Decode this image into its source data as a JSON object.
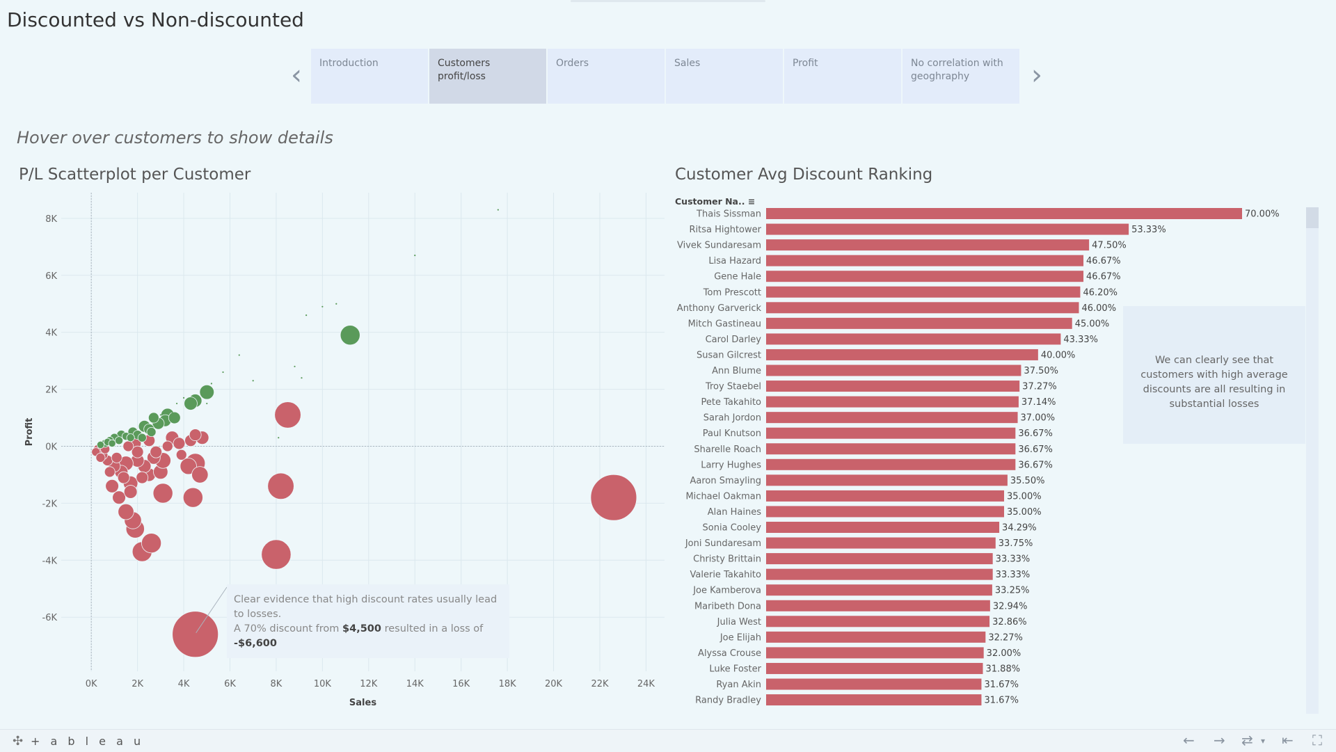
{
  "page": {
    "title": "Discounted vs Non-discounted",
    "subtitle": "Hover over customers to show details"
  },
  "nav": {
    "prev_icon": "chevron-left-icon",
    "next_icon": "chevron-right-icon"
  },
  "tabs": [
    {
      "label": "Introduction",
      "active": false
    },
    {
      "label": "Customers profit/loss",
      "active": true
    },
    {
      "label": "Orders",
      "active": false
    },
    {
      "label": "Sales",
      "active": false
    },
    {
      "label": "Profit",
      "active": false
    },
    {
      "label": "No correlation with geoghraphy",
      "active": false
    }
  ],
  "colors": {
    "loss": "#c9626b",
    "profit": "#5a9a5a",
    "background": "#eef7fa",
    "tab_active": "#d1d9e7",
    "tab": "#e3ecfa"
  },
  "scatter": {
    "title": "P/L Scatterplot per Customer",
    "annotation": {
      "line1": "Clear evidence that high discount rates usually lead to losses.",
      "line2a": "A 70% discount from",
      "line2b": "$4,500",
      "line2c": "resulted in a loss of",
      "line3": "-$6,600"
    }
  },
  "ranking": {
    "title": "Customer Avg Discount Ranking",
    "header": "Customer Na..",
    "annotation": "We can clearly see that customers with high average discounts are all resulting in substantial losses"
  },
  "chart_data": [
    {
      "type": "scatter",
      "title": "P/L Scatterplot per Customer",
      "xlabel": "Sales",
      "ylabel": "Profit",
      "xlim": [
        -1300,
        24800
      ],
      "ylim": [
        -7900,
        8900
      ],
      "x_ticks": [
        "0K",
        "2K",
        "4K",
        "6K",
        "8K",
        "10K",
        "12K",
        "14K",
        "16K",
        "18K",
        "20K",
        "22K",
        "24K"
      ],
      "y_ticks": [
        "-6K",
        "-4K",
        "-2K",
        "0K",
        "2K",
        "4K",
        "6K",
        "8K"
      ],
      "x_tick_values": [
        0,
        2000,
        4000,
        6000,
        8000,
        10000,
        12000,
        14000,
        16000,
        18000,
        20000,
        22000,
        24000
      ],
      "y_tick_values": [
        -6000,
        -4000,
        -2000,
        0,
        2000,
        4000,
        6000,
        8000
      ],
      "grid": true,
      "series": [
        {
          "points": [
            [
              22600,
              -1800,
              0.7
            ],
            [
              4500,
              -6600,
              0.7
            ],
            [
              8500,
              1100,
              0.4
            ],
            [
              8200,
              -1400,
              0.4
            ],
            [
              8000,
              -3800,
              0.45
            ],
            [
              4400,
              -1800,
              0.3
            ],
            [
              4500,
              -600,
              0.3
            ],
            [
              4200,
              -700,
              0.25
            ],
            [
              4700,
              -1000,
              0.25
            ],
            [
              3100,
              -1650,
              0.3
            ],
            [
              2200,
              -3700,
              0.3
            ],
            [
              2600,
              -3400,
              0.3
            ],
            [
              1900,
              -2900,
              0.28
            ],
            [
              1800,
              -2600,
              0.26
            ],
            [
              1500,
              -2300,
              0.24
            ],
            [
              1200,
              -1800,
              0.2
            ],
            [
              900,
              -1400,
              0.2
            ],
            [
              1700,
              -1300,
              0.22
            ],
            [
              2500,
              -1000,
              0.2
            ],
            [
              3000,
              -900,
              0.22
            ],
            [
              3100,
              -500,
              0.24
            ],
            [
              2700,
              -400,
              0.2
            ],
            [
              2300,
              -700,
              0.2
            ],
            [
              2000,
              -500,
              0.2
            ],
            [
              1500,
              -600,
              0.22
            ],
            [
              1300,
              -900,
              0.2
            ],
            [
              1000,
              -700,
              0.18
            ],
            [
              700,
              -500,
              0.16
            ],
            [
              500,
              -300,
              0.15
            ],
            [
              300,
              -100,
              0.14
            ],
            [
              200,
              -200,
              0.13
            ],
            [
              1900,
              100,
              0.18
            ],
            [
              2500,
              200,
              0.18
            ],
            [
              3500,
              300,
              0.2
            ],
            [
              3800,
              100,
              0.18
            ],
            [
              4300,
              200,
              0.18
            ],
            [
              4800,
              300,
              0.2
            ],
            [
              4500,
              400,
              0.18
            ],
            [
              3300,
              0,
              0.16
            ],
            [
              2000,
              -200,
              0.18
            ],
            [
              1100,
              -400,
              0.16
            ],
            [
              800,
              -900,
              0.16
            ],
            [
              1400,
              -1100,
              0.18
            ],
            [
              1700,
              -1600,
              0.2
            ],
            [
              600,
              -100,
              0.14
            ],
            [
              400,
              -400,
              0.14
            ],
            [
              2800,
              -200,
              0.18
            ],
            [
              1600,
              0,
              0.16
            ],
            [
              3900,
              -300,
              0.16
            ],
            [
              2200,
              -1100,
              0.18
            ]
          ],
          "color": "loss"
        },
        {
          "points": [
            [
              11200,
              3900,
              0.3
            ],
            [
              5000,
              1900,
              0.22
            ],
            [
              4500,
              1600,
              0.2
            ],
            [
              4300,
              1500,
              0.2
            ],
            [
              3300,
              1100,
              0.2
            ],
            [
              3200,
              900,
              0.18
            ],
            [
              2900,
              800,
              0.18
            ],
            [
              2300,
              700,
              0.18
            ],
            [
              2500,
              600,
              0.16
            ],
            [
              1800,
              500,
              0.15
            ],
            [
              1300,
              400,
              0.14
            ],
            [
              1000,
              300,
              0.13
            ],
            [
              800,
              200,
              0.12
            ],
            [
              2000,
              400,
              0.14
            ],
            [
              2700,
              1000,
              0.16
            ],
            [
              600,
              100,
              0.12
            ],
            [
              1500,
              350,
              0.12
            ],
            [
              3600,
              1000,
              0.18
            ],
            [
              2200,
              300,
              0.13
            ],
            [
              1200,
              200,
              0.12
            ],
            [
              400,
              50,
              0.11
            ],
            [
              1700,
              300,
              0.12
            ],
            [
              700,
              150,
              0.11
            ],
            [
              2600,
              500,
              0.14
            ],
            [
              900,
              100,
              0.11
            ]
          ],
          "color": "profit"
        },
        {
          "points": [
            [
              17600,
              8300,
              0.01
            ],
            [
              14000,
              6700,
              0.01
            ],
            [
              10600,
              5000,
              0.01
            ],
            [
              10000,
              4900,
              0.01
            ],
            [
              9300,
              4600,
              0.01
            ],
            [
              6400,
              3200,
              0.01
            ],
            [
              8800,
              2800,
              0.01
            ],
            [
              9100,
              2400,
              0.01
            ],
            [
              7000,
              2300,
              0.01
            ],
            [
              5700,
              2600,
              0.01
            ],
            [
              5200,
              2200,
              0.01
            ],
            [
              4800,
              1800,
              0.01
            ],
            [
              4000,
              1700,
              0.01
            ],
            [
              3700,
              1500,
              0.01
            ],
            [
              3500,
              1200,
              0.01
            ],
            [
              8100,
              300,
              0.01
            ],
            [
              5000,
              1500,
              0.01
            ],
            [
              3000,
              1100,
              0.01
            ]
          ],
          "color": "profit"
        }
      ]
    },
    {
      "type": "bar",
      "title": "Customer Avg Discount Ranking",
      "orientation": "horizontal",
      "categories": [
        "Thais Sissman",
        "Ritsa Hightower",
        "Vivek Sundaresam",
        "Lisa Hazard",
        "Gene Hale",
        "Tom Prescott",
        "Anthony Garverick",
        "Mitch Gastineau",
        "Carol Darley",
        "Susan Gilcrest",
        "Ann Blume",
        "Troy Staebel",
        "Pete Takahito",
        "Sarah Jordon",
        "Paul Knutson",
        "Sharelle Roach",
        "Larry Hughes",
        "Aaron Smayling",
        "Michael Oakman",
        "Alan Haines",
        "Sonia Cooley",
        "Joni Sundaresam",
        "Christy Brittain",
        "Valerie Takahito",
        "Joe Kamberova",
        "Maribeth Dona",
        "Julia West",
        "Joe Elijah",
        "Alyssa Crouse",
        "Luke Foster",
        "Ryan Akin",
        "Randy Bradley"
      ],
      "values": [
        70.0,
        53.33,
        47.5,
        46.67,
        46.67,
        46.2,
        46.0,
        45.0,
        43.33,
        40.0,
        37.5,
        37.27,
        37.14,
        37.0,
        36.67,
        36.67,
        36.67,
        35.5,
        35.0,
        35.0,
        34.29,
        33.75,
        33.33,
        33.33,
        33.25,
        32.94,
        32.86,
        32.27,
        32.0,
        31.88,
        31.67,
        31.67
      ],
      "labels": [
        "70.00%",
        "53.33%",
        "47.50%",
        "46.67%",
        "46.67%",
        "46.20%",
        "46.00%",
        "45.00%",
        "43.33%",
        "40.00%",
        "37.50%",
        "37.27%",
        "37.14%",
        "37.00%",
        "36.67%",
        "36.67%",
        "36.67%",
        "35.50%",
        "35.00%",
        "35.00%",
        "34.29%",
        "33.75%",
        "33.33%",
        "33.33%",
        "33.25%",
        "32.94%",
        "32.86%",
        "32.27%",
        "32.00%",
        "31.88%",
        "31.67%",
        "31.67%"
      ],
      "xlim": [
        0,
        70
      ],
      "sorted": "descending"
    }
  ],
  "footer": {
    "brand": "+ a b l e a u",
    "icons": [
      "back-icon",
      "forward-icon",
      "refresh-icon",
      "revert-icon",
      "fullscreen-icon"
    ]
  }
}
